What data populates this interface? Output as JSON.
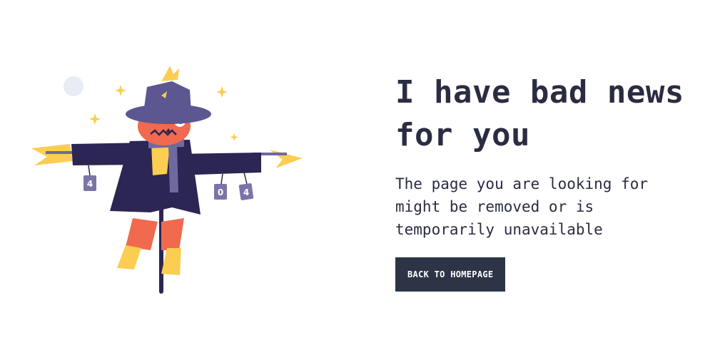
{
  "headline": "I have bad news for you",
  "message": "The page you are looking for might be removed or is temporarily unavailable",
  "back_button_label": "BACK TO HOMEPAGE",
  "illustration": {
    "tags": [
      "4",
      "0",
      "4"
    ]
  },
  "colors": {
    "text": "#2a2d42",
    "button_bg": "#2c3446",
    "button_text": "#ffffff",
    "hat": "#5c5691",
    "coat": "#2b2653",
    "face": "#f1694f",
    "straw": "#fbcd51",
    "tags": "#7a74a8",
    "moon": "#e8ecf4"
  }
}
